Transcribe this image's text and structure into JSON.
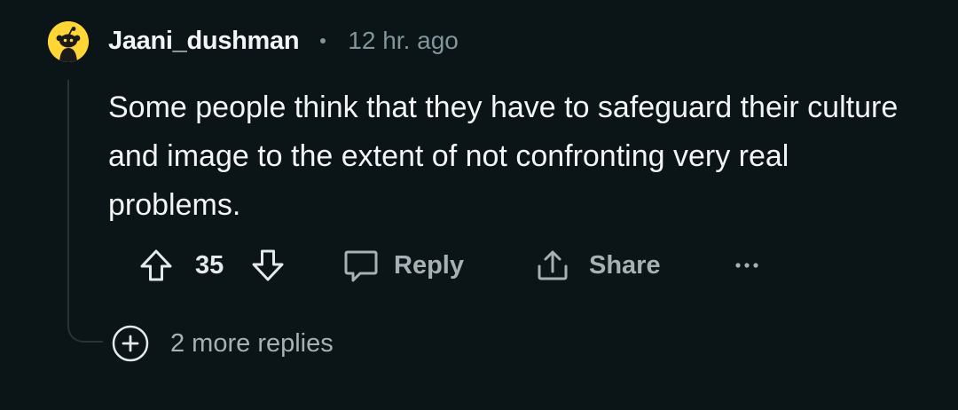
{
  "comment": {
    "username": "Jaani_dushman",
    "separator": "•",
    "time": "12 hr. ago",
    "body": "Some people think that they have to safeguard their culture and image to the extent of not confronting very real problems.",
    "avatar_icon": "snoo-avatar-icon",
    "avatar_color": "#ffd635"
  },
  "actions": {
    "upvote_icon": "arrow-up-icon",
    "vote_count": "35",
    "downvote_icon": "arrow-down-icon",
    "reply_label": "Reply",
    "reply_icon": "speech-bubble-icon",
    "share_label": "Share",
    "share_icon": "share-icon",
    "overflow_icon": "more-horizontal-icon"
  },
  "replies": {
    "expand_icon": "plus-circle-icon",
    "label": "2 more replies"
  }
}
